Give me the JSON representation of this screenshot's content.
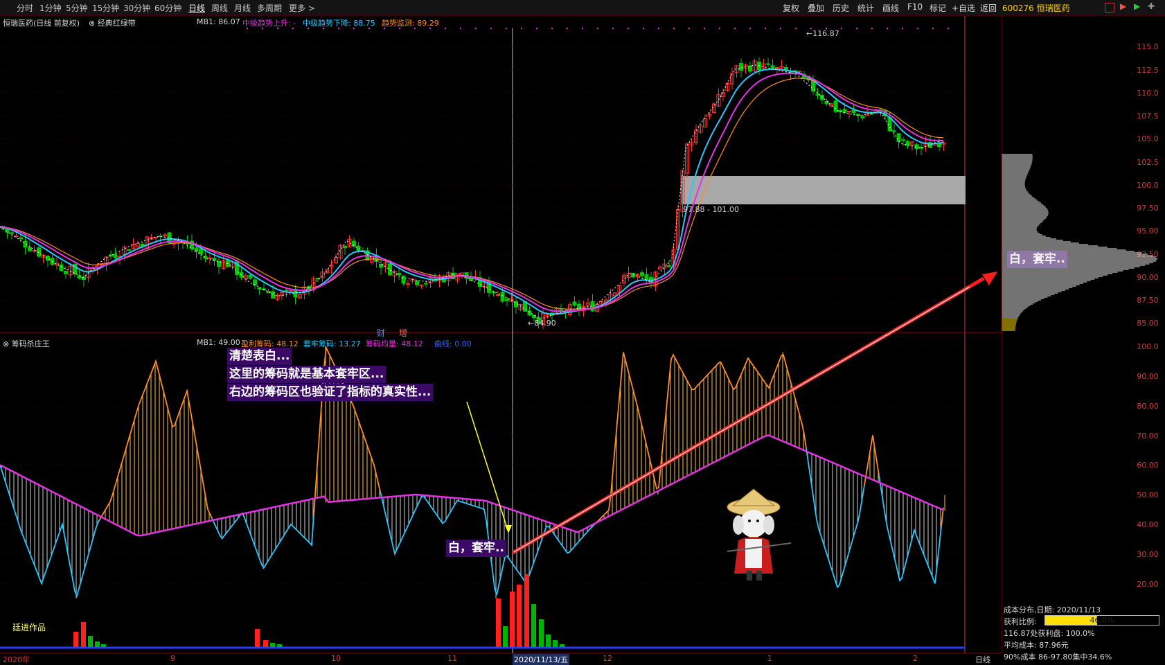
{
  "toolbar": {
    "periods": [
      "分时",
      "1分钟",
      "5分钟",
      "15分钟",
      "30分钟",
      "60分钟",
      "日线",
      "周线",
      "月线",
      "多周期",
      "更多 >"
    ],
    "active_period": "日线",
    "tools": [
      "复权",
      "叠加",
      "历史",
      "统计",
      "画线",
      "F10",
      "标记",
      "+自选",
      "返回"
    ]
  },
  "stock": {
    "code": "600276",
    "name": "恒瑞医药"
  },
  "main_header": {
    "title": "恒瑞医药(日线 前复权)",
    "indicator": "经典红绿带",
    "mb1": "MB1: 86.07",
    "up": "中级趋势上升: -",
    "down": "中级趋势下降: 88.75",
    "monitor": "趋势监测: 89.29"
  },
  "main_axis": {
    "ticks": [
      "115.0",
      "112.5",
      "110.0",
      "107.5",
      "105.0",
      "102.5",
      "100.0",
      "97.50",
      "95.00",
      "92.50",
      "90.00",
      "87.50",
      "85.00"
    ]
  },
  "main_marks": {
    "high": "116.87",
    "low": "84.90",
    "range": "97.88 - 101.00",
    "cai": "财",
    "zeng": "增"
  },
  "sub_header": {
    "name": "筹码杀庄王",
    "mb1": "MB1: 49.00",
    "profit": "盈利筹码: 48.12",
    "trapped": "套牢筹码: 13.27",
    "avg": "筹码均量: 48.12",
    "curve": "曲线: 0.00"
  },
  "sub_axis": {
    "ticks": [
      "100.0",
      "90.00",
      "80.00",
      "70.00",
      "60.00",
      "50.00",
      "40.00",
      "30.00",
      "20.00"
    ]
  },
  "sub_marks": {
    "author": "廷进作品"
  },
  "annotations": {
    "line1": "清楚表白...",
    "line2": "这里的筹码就是基本套牢区...",
    "line3": "右边的筹码区也验证了指标的真实性...",
    "note_left": "白，套牢..",
    "note_right": "白，套牢.."
  },
  "x_axis": {
    "labels": [
      "2020年",
      "9",
      "10",
      "11",
      "2020/11/13/五",
      "12",
      "1",
      "2"
    ],
    "period": "日线"
  },
  "chip_info": {
    "l1": "成本分布,日期: 2020/11/13",
    "l2_label": "获利比例:",
    "l2_value": "46.0%",
    "profit_ratio": 0.46,
    "l3": "116.87处获利盘: 100.0%",
    "l4": "平均成本: 87.96元",
    "l5": "90%成本 86-97.80集中34.6%"
  },
  "colors": {
    "up": "#ff3232",
    "down": "#00c800",
    "ma1": "#28c8ff",
    "ma2": "#ff8c28",
    "ma3": "#e632e6",
    "axis": "#d23c3c"
  }
}
